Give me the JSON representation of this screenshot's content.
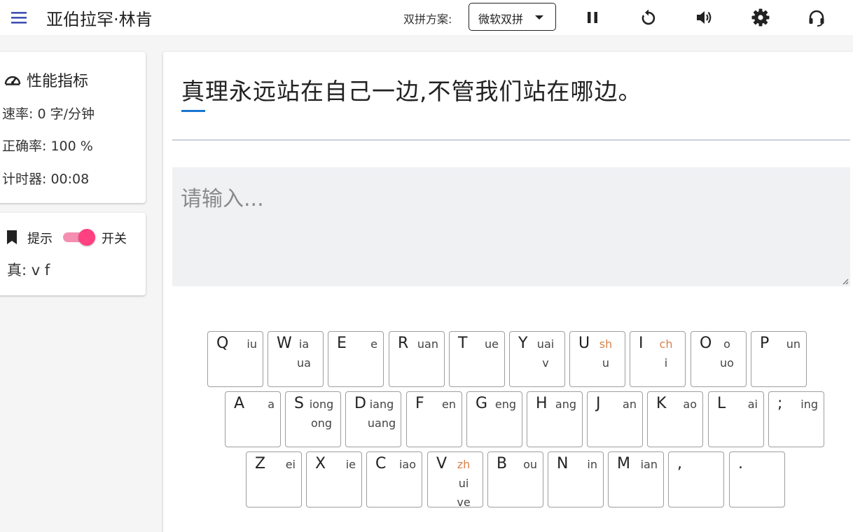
{
  "app": {
    "title": "亚伯拉罕·林肯"
  },
  "toolbar": {
    "scheme_label": "双拼方案:",
    "scheme_value": "微软双拼",
    "icons": [
      "menu-icon",
      "pause-icon",
      "restart-icon",
      "volume-icon",
      "settings-icon",
      "headset-icon"
    ]
  },
  "performance": {
    "title": "性能指标",
    "speed": "速率: 0 字/分钟",
    "accuracy": "正确率: 100 %",
    "timer": "计时器: 00:08"
  },
  "hint": {
    "label": "提示",
    "switch_label": "开关",
    "enabled": true,
    "text": "真: v f"
  },
  "practice": {
    "current_char": "真",
    "rest_text": "理永远站在自己一边,不管我们站在哪边。",
    "input_placeholder": "请输入...",
    "input_value": ""
  },
  "colors": {
    "accent_blue": "#1976d2",
    "toggle_pink": "#ff4081",
    "hint_orange": "#d9824b"
  },
  "keyboard": {
    "rows": [
      [
        {
          "k": "Q",
          "v": [
            "iu"
          ]
        },
        {
          "k": "W",
          "v": [
            "ia",
            "ua"
          ]
        },
        {
          "k": "E",
          "v": [
            "e"
          ]
        },
        {
          "k": "R",
          "v": [
            "uan"
          ]
        },
        {
          "k": "T",
          "v": [
            "ue"
          ]
        },
        {
          "k": "Y",
          "v": [
            "uai",
            "v"
          ]
        },
        {
          "k": "U",
          "v": [
            "sh",
            "u"
          ],
          "hl": [
            0
          ]
        },
        {
          "k": "I",
          "v": [
            "ch",
            "i"
          ],
          "hl": [
            0
          ]
        },
        {
          "k": "O",
          "v": [
            "o",
            "uo"
          ]
        },
        {
          "k": "P",
          "v": [
            "un"
          ]
        }
      ],
      [
        {
          "k": "A",
          "v": [
            "a"
          ]
        },
        {
          "k": "S",
          "v": [
            "iong",
            "ong"
          ]
        },
        {
          "k": "D",
          "v": [
            "iang",
            "uang"
          ]
        },
        {
          "k": "F",
          "v": [
            "en"
          ]
        },
        {
          "k": "G",
          "v": [
            "eng"
          ]
        },
        {
          "k": "H",
          "v": [
            "ang"
          ]
        },
        {
          "k": "J",
          "v": [
            "an"
          ]
        },
        {
          "k": "K",
          "v": [
            "ao"
          ]
        },
        {
          "k": "L",
          "v": [
            "ai"
          ]
        },
        {
          "k": ";",
          "v": [
            "ing"
          ]
        }
      ],
      [
        {
          "k": "Z",
          "v": [
            "ei"
          ]
        },
        {
          "k": "X",
          "v": [
            "ie"
          ]
        },
        {
          "k": "C",
          "v": [
            "iao"
          ]
        },
        {
          "k": "V",
          "v": [
            "zh",
            "ui",
            "ve"
          ],
          "hl": [
            0
          ]
        },
        {
          "k": "B",
          "v": [
            "ou"
          ]
        },
        {
          "k": "N",
          "v": [
            "in"
          ]
        },
        {
          "k": "M",
          "v": [
            "ian"
          ]
        },
        {
          "k": ",",
          "v": []
        },
        {
          "k": ".",
          "v": []
        }
      ]
    ]
  }
}
